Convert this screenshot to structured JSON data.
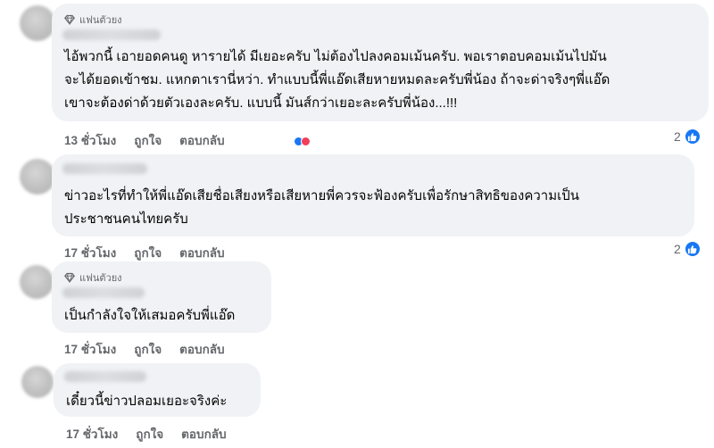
{
  "comments": [
    {
      "badge": "แฟนตัวยง",
      "lines": [
        "ไอ้พวกนี้ เอายอดคนดู หารายได้ มีเยอะครับ ไม่ต้องไปลงคอมเม้นครับ. พอเราตอบคอมเม้นไปมัน",
        "จะได้ยอดเข้าชม. แหกตาเรานี่หว่า. ทำแบบนี้พี่แอ๊ดเสียหายหมดละครับพี่น้อง ถ้าจะด่าจริงๆพี่แอ๊ด",
        "เขาจะต้องด่าด้วยตัวเองละครับ. แบบนี้ มันส์กว่าเยอะละครับพี่น้อง...!!!"
      ],
      "time": "13 ชั่วโมง",
      "like": "ถูกใจ",
      "reply": "ตอบกลับ",
      "reactions": "2"
    },
    {
      "lines": [
        "ข่าวอะไรที่ทำให้พี่แอ๊ดเสียชื่อเสียงหรือเสียหายพี่ควรจะฟ้องครับเพื่อรักษาสิทธิของความเป็น",
        "ประชาชนคนไทยครับ"
      ],
      "time": "17 ชั่วโมง",
      "like": "ถูกใจ",
      "reply": "ตอบกลับ",
      "reactions": "2"
    },
    {
      "badge": "แฟนตัวยง",
      "lines": [
        "เป็นกำลังใจให้เสมอครับพี่แอ๊ด"
      ],
      "time": "17 ชั่วโมง",
      "like": "ถูกใจ",
      "reply": "ตอบกลับ"
    },
    {
      "lines": [
        "เดี๋ยวนี้ข่าวปลอมเยอะจริงค่ะ"
      ],
      "time": "17 ชั่วโมง",
      "like": "ถูกใจ",
      "reply": "ตอบกลับ"
    }
  ],
  "icons": {
    "badge": "diamond-icon",
    "like": "thumbs-up-icon"
  },
  "colors": {
    "like_blue": "#1877f2",
    "bubble_bg": "#f0f2f5",
    "meta_gray": "#65676b"
  }
}
